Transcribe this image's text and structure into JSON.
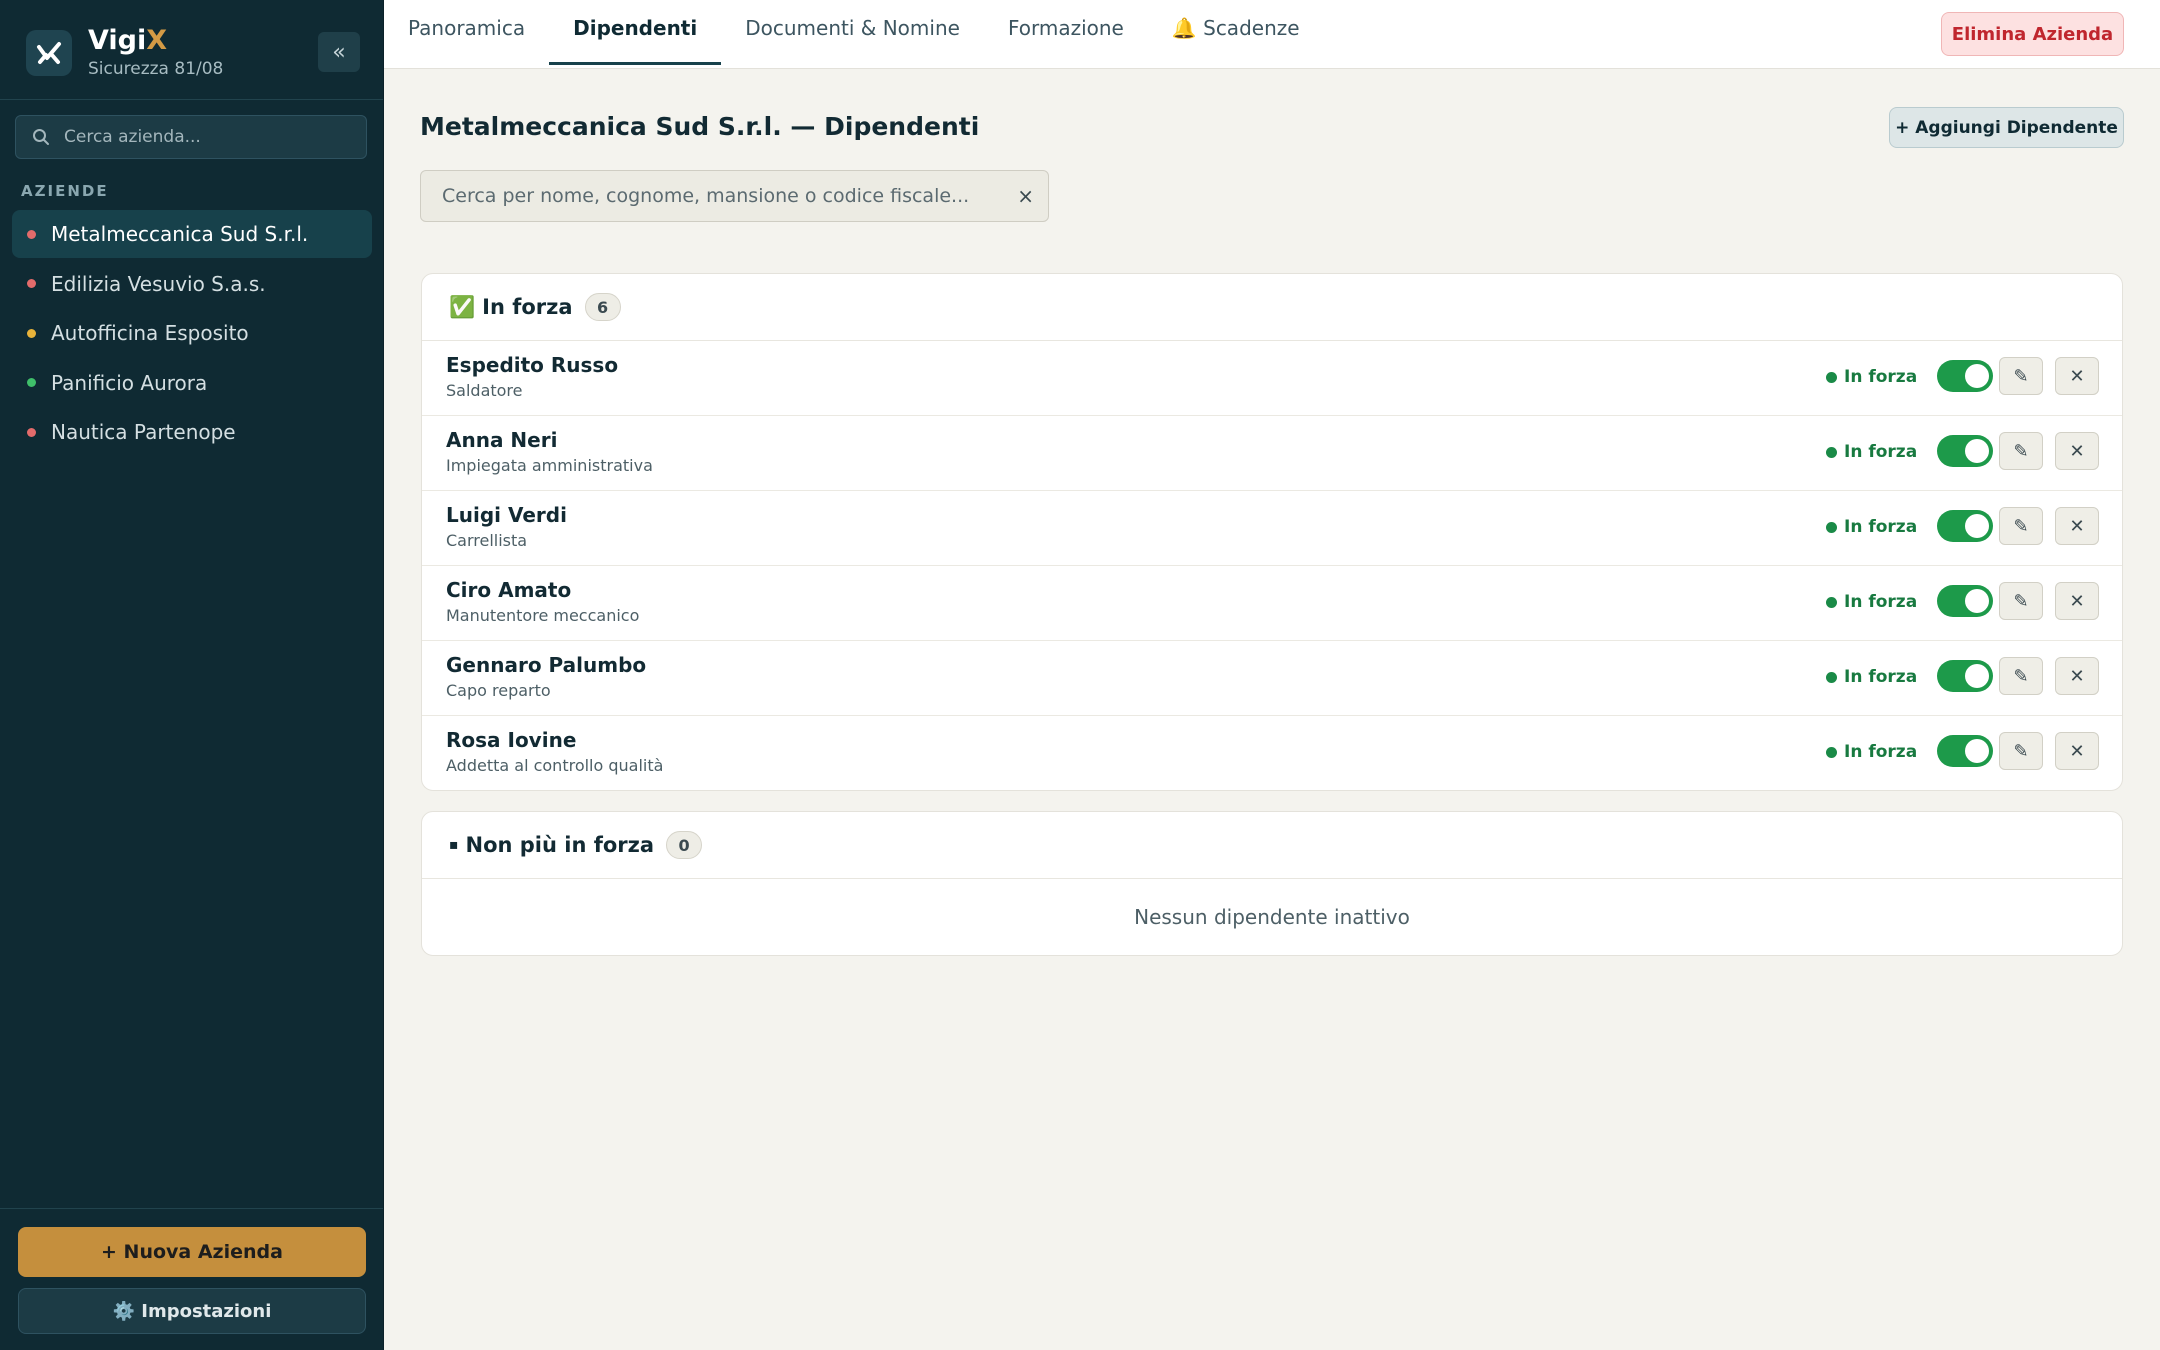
{
  "brand": {
    "name_main": "Vigi",
    "name_accent": "X",
    "subtitle": "Sicurezza 81/08"
  },
  "sidebar": {
    "collapse_label": "«",
    "search_placeholder": "Cerca azienda...",
    "section_label": "AZIENDE",
    "companies": [
      {
        "name": "Metalmeccanica Sud S.r.l.",
        "status_color": "#e36b6b",
        "active": true
      },
      {
        "name": "Edilizia Vesuvio S.a.s.",
        "status_color": "#e36b6b",
        "active": false
      },
      {
        "name": "Autofficina Esposito",
        "status_color": "#e8b33a",
        "active": false
      },
      {
        "name": "Panificio Aurora",
        "status_color": "#3fbf6a",
        "active": false
      },
      {
        "name": "Nautica Partenope",
        "status_color": "#e36b6b",
        "active": false
      }
    ],
    "new_company_label": "+ Nuova Azienda",
    "settings_label": "⚙️ Impostazioni"
  },
  "topbar": {
    "tabs": [
      {
        "label": "Panoramica",
        "active": false
      },
      {
        "label": "Dipendenti",
        "active": true
      },
      {
        "label": "Documenti & Nomine",
        "active": false
      },
      {
        "label": "Formazione",
        "active": false
      },
      {
        "label": "🔔 Scadenze",
        "active": false
      }
    ],
    "delete_label": "Elimina Azienda"
  },
  "main": {
    "title": "Metalmeccanica Sud S.r.l. — Dipendenti",
    "add_label": "+ Aggiungi Dipendente",
    "search_placeholder": "Cerca per nome, cognome, mansione o codice fiscale...",
    "clear_label": "×",
    "active_section": {
      "icon": "✅",
      "title": "In forza",
      "count": "6",
      "employees": [
        {
          "name": "Espedito Russo",
          "role": "Saldatore",
          "status": "In forza",
          "enabled": true
        },
        {
          "name": "Anna Neri",
          "role": "Impiegata amministrativa",
          "status": "In forza",
          "enabled": true
        },
        {
          "name": "Luigi Verdi",
          "role": "Carrellista",
          "status": "In forza",
          "enabled": true
        },
        {
          "name": "Ciro Amato",
          "role": "Manutentore meccanico",
          "status": "In forza",
          "enabled": true
        },
        {
          "name": "Gennaro Palumbo",
          "role": "Capo reparto",
          "status": "In forza",
          "enabled": true
        },
        {
          "name": "Rosa Iovine",
          "role": "Addetta al controllo qualità",
          "status": "In forza",
          "enabled": true
        }
      ]
    },
    "inactive_section": {
      "icon": "▪",
      "title": "Non più in forza",
      "count": "0",
      "empty_text": "Nessun dipendente inattivo"
    },
    "edit_icon": "✎",
    "remove_icon": "✕"
  },
  "colors": {
    "sidebar_bg": "#0f2a33",
    "accent": "#c58f3d",
    "status_green": "#1a8a47",
    "danger": "#c0262e"
  }
}
